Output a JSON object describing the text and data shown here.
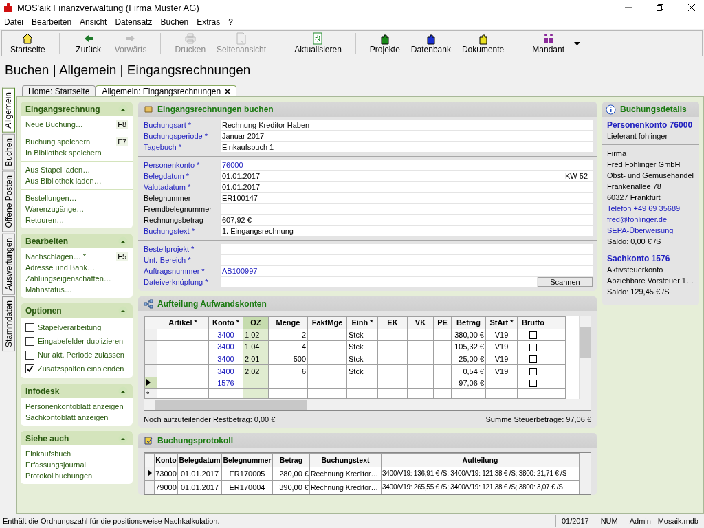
{
  "window": {
    "title": "MOS'aik Finanzverwaltung (Firma Muster AG)"
  },
  "menu": [
    "Datei",
    "Bearbeiten",
    "Ansicht",
    "Datensatz",
    "Buchen",
    "Extras",
    "?"
  ],
  "toolbar": [
    {
      "label": "Startseite",
      "kind": "home",
      "disabled": false
    },
    {
      "label": "Zurück",
      "kind": "back",
      "disabled": false
    },
    {
      "label": "Vorwärts",
      "kind": "forward",
      "disabled": true
    },
    {
      "label": "Drucken",
      "kind": "print",
      "disabled": true
    },
    {
      "label": "Seitenansicht",
      "kind": "preview",
      "disabled": true
    },
    {
      "label": "Aktualisieren",
      "kind": "refresh",
      "disabled": false
    },
    {
      "label": "Projekte",
      "kind": "projects",
      "disabled": false
    },
    {
      "label": "Datenbank",
      "kind": "database",
      "disabled": false
    },
    {
      "label": "Dokumente",
      "kind": "documents",
      "disabled": false
    },
    {
      "label": "Mandant",
      "kind": "client",
      "disabled": false
    }
  ],
  "heading": "Buchen | Allgemein | Eingangsrechnungen",
  "side_tabs": [
    {
      "label": "Allgemein",
      "selected": true
    },
    {
      "label": "Buchen",
      "selected": false
    },
    {
      "label": "Offene Posten",
      "selected": false
    },
    {
      "label": "Auswertungen",
      "selected": false
    },
    {
      "label": "Stammdaten",
      "selected": false
    }
  ],
  "doc_tabs": [
    {
      "label": "Home: Startseite",
      "selected": false
    },
    {
      "label": "Allgemein: Eingangsrechnungen",
      "selected": true
    }
  ],
  "sidebar": [
    {
      "title": "Eingangsrechnung",
      "kind": "links",
      "groups": [
        [
          {
            "label": "Neue Buchung…",
            "shortcut": "F8"
          }
        ],
        [
          {
            "label": "Buchung speichern",
            "shortcut": "F7"
          },
          {
            "label": "In Bibliothek speichern"
          }
        ],
        [
          {
            "label": "Aus Stapel laden…"
          },
          {
            "label": "Aus Bibliothek laden…"
          }
        ],
        [
          {
            "label": "Bestellungen…"
          },
          {
            "label": "Warenzugänge…"
          },
          {
            "label": "Retouren…"
          }
        ]
      ]
    },
    {
      "title": "Bearbeiten",
      "kind": "links",
      "groups": [
        [
          {
            "label": "Nachschlagen… *",
            "shortcut": "F5"
          },
          {
            "label": "Adresse und Bank…"
          },
          {
            "label": "Zahlungseigenschaften…"
          },
          {
            "label": "Mahnstatus…"
          }
        ]
      ]
    },
    {
      "title": "Optionen",
      "kind": "checkboxes",
      "items": [
        {
          "label": "Stapelverarbeitung",
          "checked": false
        },
        {
          "label": "Eingabefelder duplizieren",
          "checked": false
        },
        {
          "label": "Nur akt. Periode zulassen",
          "checked": false
        },
        {
          "label": "Zusatzspalten einblenden",
          "checked": true
        }
      ]
    },
    {
      "title": "Infodesk",
      "kind": "links",
      "groups": [
        [
          {
            "label": "Personenkontoblatt anzeigen"
          },
          {
            "label": "Sachkontoblatt anzeigen"
          }
        ]
      ]
    },
    {
      "title": "Siehe auch",
      "kind": "links",
      "groups": [
        [
          {
            "label": "Einkaufsbuch"
          },
          {
            "label": "Erfassungsjournal"
          },
          {
            "label": "Protokollbuchungen"
          }
        ]
      ]
    }
  ],
  "form": {
    "title": "Eingangsrechnungen buchen",
    "groups": [
      [
        {
          "label": "Buchungsart *",
          "value": "Rechnung Kreditor Haben",
          "required": true,
          "linked": false
        },
        {
          "label": "Buchungsperiode *",
          "value": "Januar 2017",
          "required": true,
          "linked": false
        },
        {
          "label": "Tagebuch *",
          "value": "Einkaufsbuch 1",
          "required": true,
          "linked": false
        }
      ],
      [
        {
          "label": "Personenkonto *",
          "value": "76000",
          "required": true,
          "linked": true
        },
        {
          "label": "Belegdatum *",
          "value": "01.01.2017",
          "required": true,
          "linked": false,
          "suffix": "KW 52"
        },
        {
          "label": "Valutadatum *",
          "value": "01.01.2017",
          "required": true,
          "linked": false
        },
        {
          "label": "Belegnummer",
          "value": "ER100147",
          "required": false,
          "linked": false
        },
        {
          "label": "Fremdbelegnummer",
          "required": false
        },
        {
          "label": "Rechnungsbetrag",
          "value": "607,92 €",
          "required": false,
          "linked": false
        },
        {
          "label": "Buchungstext *",
          "value": "1. Eingangsrechnung",
          "required": true,
          "linked": false
        }
      ],
      [
        {
          "label": "Bestellprojekt *",
          "required": true
        },
        {
          "label": "Unt.-Bereich *",
          "required": true
        },
        {
          "label": "Auftragsnummer *",
          "value": "AB100997",
          "required": true,
          "linked": true
        },
        {
          "label": "Dateiverknüpfung *",
          "required": true,
          "button": "Scannen"
        }
      ]
    ]
  },
  "split": {
    "title": "Aufteilung Aufwandskonten",
    "columns": [
      "Artikel *",
      "Konto *",
      "OZ",
      "Menge",
      "FaktMge",
      "Einh *",
      "EK",
      "VK",
      "PE",
      "Betrag",
      "StArt *",
      "Brutto"
    ],
    "rows": [
      {
        "selected": false,
        "brutto": false,
        "cells": [
          "",
          "3400",
          "1.02",
          "2",
          "",
          "Stck",
          "",
          "",
          "",
          "380,00 €",
          "V19"
        ]
      },
      {
        "selected": false,
        "brutto": false,
        "cells": [
          "",
          "3400",
          "1.04",
          "4",
          "",
          "Stck",
          "",
          "",
          "",
          "105,32 €",
          "V19"
        ]
      },
      {
        "selected": false,
        "brutto": false,
        "cells": [
          "",
          "3400",
          "2.01",
          "500",
          "",
          "Stck",
          "",
          "",
          "",
          "25,00 €",
          "V19"
        ]
      },
      {
        "selected": false,
        "brutto": false,
        "cells": [
          "",
          "3400",
          "2.02",
          "6",
          "",
          "Stck",
          "",
          "",
          "",
          "0,54 €",
          "V19"
        ]
      },
      {
        "selected": true,
        "brutto": false,
        "cells": [
          "",
          "1576",
          "",
          "",
          "",
          "",
          "",
          "",
          "",
          "97,06 €",
          ""
        ]
      }
    ],
    "new_row_marker": "*",
    "rest": "Noch aufzuteilender Restbetrag: 0,00 €",
    "tax_sum": "Summe Steuerbeträge: 97,06 €"
  },
  "protocol": {
    "title": "Buchungsprotokoll",
    "columns": [
      "Konto",
      "Belegdatum",
      "Belegnummer",
      "Betrag",
      "Buchungstext",
      "Aufteilung"
    ],
    "rows": [
      {
        "selected": true,
        "cells": [
          "73000",
          "01.01.2017",
          "ER170005",
          "280,00 €",
          "Rechnung Kreditor…",
          "3400/V19: 136,91 € /S; 3400/V19: 121,38 € /S; 3800: 21,71 € /S"
        ]
      },
      {
        "selected": false,
        "cells": [
          "79000",
          "01.01.2017",
          "ER170004",
          "390,00 €",
          "Rechnung Kreditor…",
          "3400/V19: 265,55 € /S; 3400/V19: 121,38 € /S; 3800: 3,07 € /S"
        ]
      }
    ]
  },
  "details": {
    "title": "Buchungsdetails",
    "blocks": [
      {
        "heading": "Personenkonto 76000",
        "lines": [
          {
            "text": "Lieferant fohlinger",
            "link": false
          }
        ]
      },
      {
        "lines": [
          {
            "text": "Firma",
            "link": false
          },
          {
            "text": "Fred Fohlinger GmbH",
            "link": false
          },
          {
            "text": "Obst- und Gemüsehandel",
            "link": false
          },
          {
            "text": "Frankenallee 78",
            "link": false
          },
          {
            "text": "60327 Frankfurt",
            "link": false
          },
          {
            "text": "Telefon +49 69 35689",
            "link": true
          },
          {
            "text": "fred@fohlinger.de",
            "link": true
          },
          {
            "text": "SEPA-Überweisung",
            "link": true
          },
          {
            "text": "Saldo: 0,00 € /S",
            "link": false
          }
        ]
      },
      {
        "heading": "Sachkonto 1576",
        "lines": [
          {
            "text": "Aktivsteuerkonto",
            "link": false
          },
          {
            "text": "Abziehbare Vorsteuer 1…",
            "link": false
          },
          {
            "text": "Saldo: 129,45 € /S",
            "link": false
          }
        ]
      }
    ]
  },
  "status_bar": {
    "message": "Enthält die Ordnungszahl für die positionsweise Nachkalkulation.",
    "panes": [
      "01/2017",
      "NUM",
      "Admin - Mosaik.mdb"
    ]
  }
}
